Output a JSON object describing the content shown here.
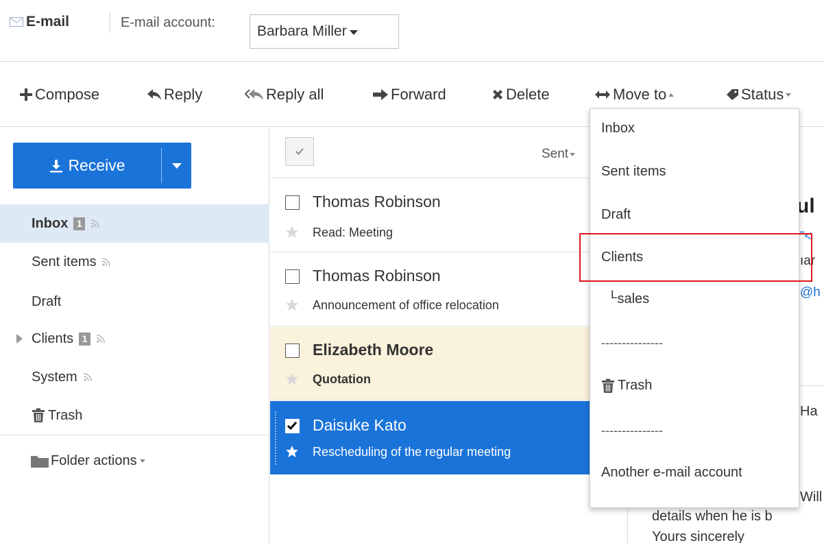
{
  "header": {
    "app_title": "E-mail",
    "account_label": "E-mail account:",
    "account_value": "Barbara Miller"
  },
  "toolbar": {
    "compose": "Compose",
    "reply": "Reply",
    "reply_all": "Reply all",
    "forward": "Forward",
    "delete": "Delete",
    "move_to": "Move to",
    "status": "Status"
  },
  "sidebar": {
    "receive_label": "Receive",
    "folders": [
      {
        "label": "Inbox",
        "badge": "1"
      },
      {
        "label": "Sent items"
      },
      {
        "label": "Draft"
      },
      {
        "label": "Clients",
        "badge": "1"
      },
      {
        "label": "System"
      },
      {
        "label": "Trash"
      }
    ],
    "folder_actions": "Folder actions"
  },
  "message_list": {
    "sort_label": "Sent",
    "messages": [
      {
        "sender": "Thomas Robinson",
        "subject": "Read: Meeting",
        "state": "read"
      },
      {
        "sender": "Thomas Robinson",
        "subject": "Announcement of office relocation",
        "state": "read"
      },
      {
        "sender": "Elizabeth Moore",
        "subject": "Quotation",
        "state": "unread"
      },
      {
        "sender": "Daisuke Kato",
        "subject": "Rescheduling of the regular meeting",
        "state": "selected"
      }
    ]
  },
  "reading_pane": {
    "title_fragment": "ul",
    "link_fragment": "\"<",
    "line2_fragment": "ıar",
    "email_fragment": "@h",
    "greeting_fragment": "Ha",
    "body_line1": "Will",
    "body_line2": "details when he is b",
    "body_line3": "Yours sincerely"
  },
  "move_menu": {
    "items": [
      "Inbox",
      "Sent items",
      "Draft",
      "Clients",
      "Lsales",
      "---------------",
      "Trash",
      "---------------",
      "Another e-mail account"
    ],
    "highlighted": "Clients"
  },
  "colors": {
    "accent": "#1a73d9",
    "unread_bg": "#fbf2dc",
    "active_folder_bg": "#dde9f5",
    "highlight_border": "#e0161b"
  }
}
